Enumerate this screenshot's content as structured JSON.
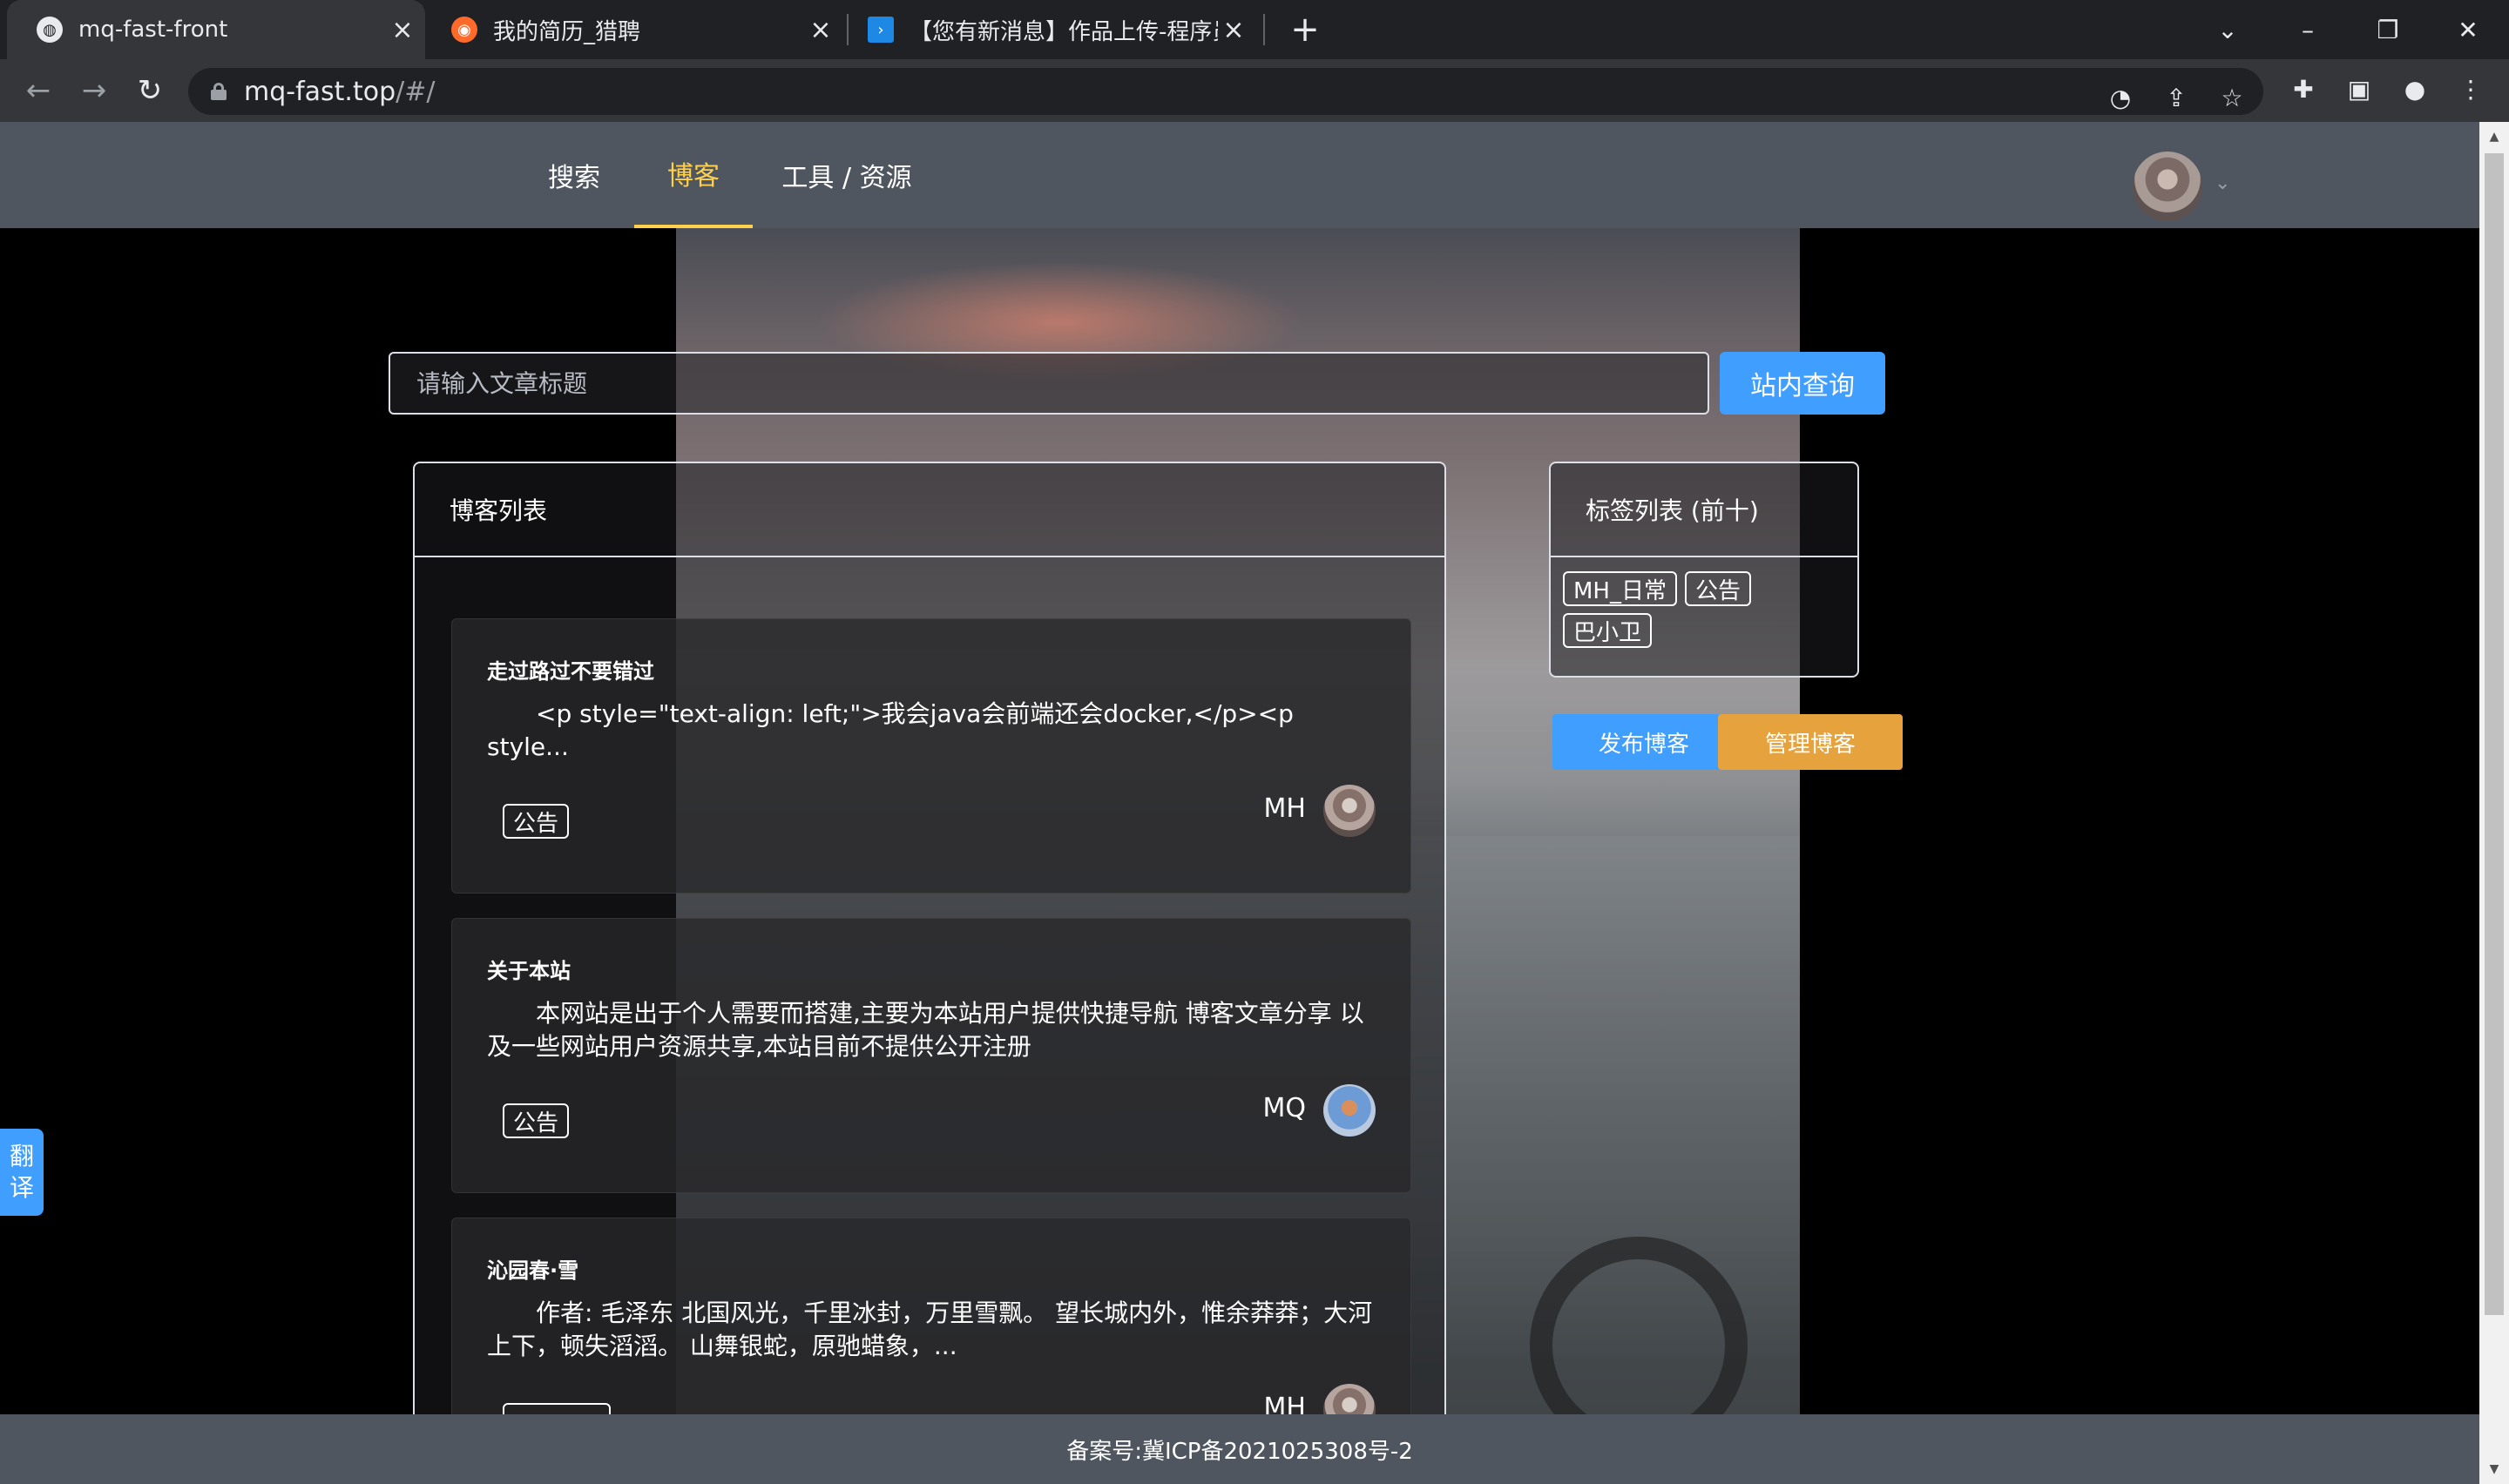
{
  "browser": {
    "tabs": [
      {
        "title": "mq-fast-front",
        "active": true
      },
      {
        "title": "我的简历_猎聘",
        "active": false
      },
      {
        "title": "【您有新消息】作品上传-程序员",
        "active": false
      }
    ],
    "url_host": "mq-fast.top",
    "url_path": "/#/"
  },
  "nav": {
    "items": [
      {
        "label": "搜索",
        "active": false
      },
      {
        "label": "博客",
        "active": true
      },
      {
        "label": "工具 / 资源",
        "active": false
      }
    ]
  },
  "search": {
    "placeholder": "请输入文章标题",
    "value": "",
    "button_label": "站内查询"
  },
  "blog_list": {
    "header": "博客列表",
    "items": [
      {
        "title": "走过路过不要错过",
        "summary": "<p style=\"text-align: left;\">我会java会前端还会docker,</p><p style...",
        "tag": "公告",
        "author": "MH"
      },
      {
        "title": "关于本站",
        "summary": "本网站是出于个人需要而搭建,主要为本站用户提供快捷导航 博客文章分享 以及一些网站用户资源共享,本站目前不提供公开注册",
        "tag": "公告",
        "author": "MQ"
      },
      {
        "title": "沁园春·雪",
        "summary": "作者: 毛泽东 北国风光，千里冰封，万里雪飘。 望长城内外，惟余莽莽；大河上下，顿失滔滔。 山舞银蛇，原驰蜡象，...",
        "tag": "",
        "author": "MH"
      }
    ]
  },
  "tags_panel": {
    "header": "标签列表 (前十)",
    "tags": [
      "MH_日常",
      "公告",
      "巴小卫"
    ]
  },
  "actions": {
    "publish_label": "发布博客",
    "manage_label": "管理博客"
  },
  "translate_label": [
    "翻",
    "译"
  ],
  "footer": {
    "text": "备案号:冀ICP备2021025308号-2"
  },
  "colors": {
    "primary": "#409eff",
    "warning": "#e6a23c",
    "nav_active": "#ffd04b",
    "nav_bg": "#4f565f"
  }
}
